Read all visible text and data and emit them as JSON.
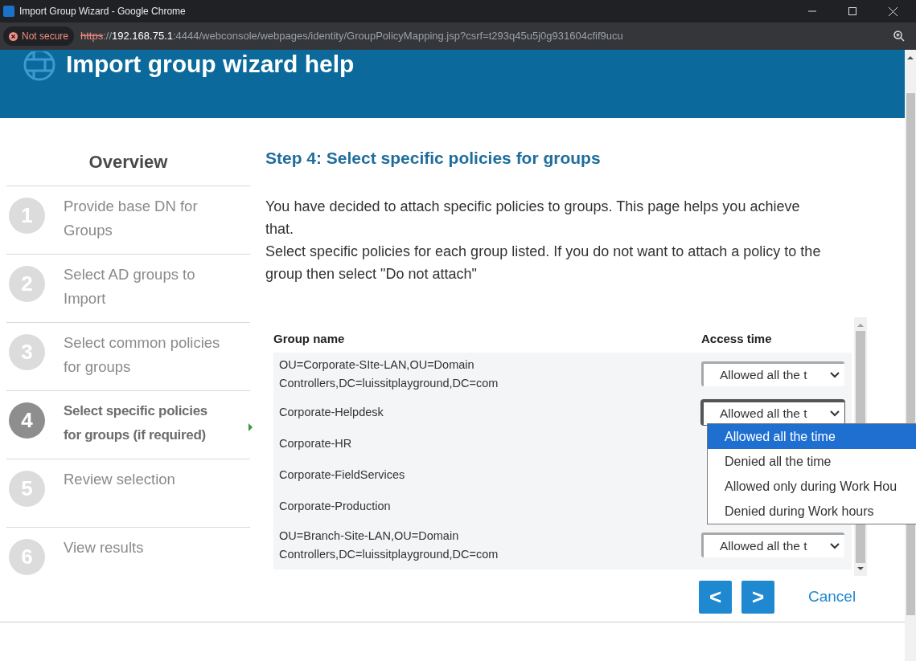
{
  "window": {
    "title": "Import Group Wizard - Google Chrome"
  },
  "address_bar": {
    "security": "Not secure",
    "scheme": "https",
    "separator": "://",
    "host": "192.168.75.1",
    "rest": ":4444/webconsole/webpages/identity/GroupPolicyMapping.jsp?csrf=t293q45u5j0g931604cfif9ucu"
  },
  "header": {
    "title": "Import group wizard help"
  },
  "sidebar": {
    "title": "Overview",
    "steps": [
      {
        "number": "1",
        "label": "Provide base DN for Groups",
        "selected": false
      },
      {
        "number": "2",
        "label": "Select AD groups to Import",
        "selected": false
      },
      {
        "number": "3",
        "label": "Select common policies for groups",
        "selected": false
      },
      {
        "number": "4",
        "label": "Select specific policies for groups (if required)",
        "selected": true
      },
      {
        "number": "5",
        "label": "Review selection",
        "selected": false
      },
      {
        "number": "6",
        "label": "View results",
        "selected": false
      }
    ]
  },
  "main": {
    "heading": "Step 4: Select specific policies for groups",
    "paragraphs": [
      "You have decided to attach specific policies to groups. This page helps you achieve that.",
      "Select specific policies for each group listed. If you do not want to attach a policy to the group then select \"Do not attach\""
    ]
  },
  "table": {
    "columns": [
      "Group name",
      "Access time"
    ],
    "rows": [
      {
        "group": "OU=Corporate-SIte-LAN,OU=Domain Controllers,DC=luissitplayground,DC=com",
        "access_time": "Allowed all the t"
      },
      {
        "group": "Corporate-Helpdesk",
        "access_time": "Allowed all the t",
        "expanded": true
      },
      {
        "group": "Corporate-HR"
      },
      {
        "group": "Corporate-FieldServices"
      },
      {
        "group": "Corporate-Production"
      },
      {
        "group": "OU=Branch-Site-LAN,OU=Domain Controllers,DC=luissitplayground,DC=com",
        "access_time": "Allowed all the t"
      }
    ]
  },
  "dropdown": {
    "options": [
      {
        "label": "Allowed all the time",
        "selected": true
      },
      {
        "label": "Denied all the time",
        "selected": false
      },
      {
        "label": "Allowed only during Work Hou",
        "selected": false
      },
      {
        "label": "Denied during Work hours",
        "selected": false
      }
    ]
  },
  "footer": {
    "back": "<",
    "next": ">",
    "cancel": "Cancel"
  }
}
